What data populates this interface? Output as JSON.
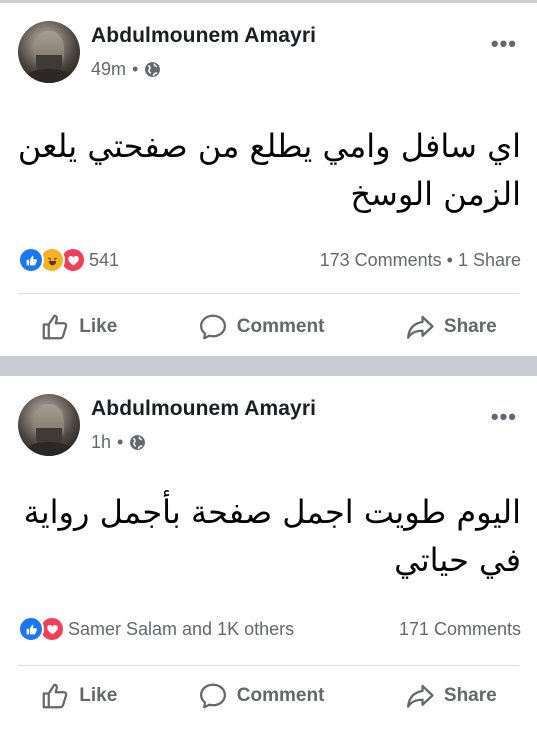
{
  "posts": [
    {
      "author": "Abdulmounem Amayri",
      "time": "49m",
      "time_sep": "•",
      "more": "•••",
      "text": "اي سافل وامي يطلع من صفحتي يلعن الزمن الوسخ",
      "reactions_text": "541",
      "counts_text": "173 Comments • 1 Share",
      "reactions": [
        "like-icon",
        "haha-icon",
        "love-icon"
      ]
    },
    {
      "author": "Abdulmounem Amayri",
      "time": "1h",
      "time_sep": "•",
      "more": "•••",
      "text": "اليوم طويت اجمل صفحة بأجمل رواية في حياتي",
      "reactions_text": "Samer Salam and 1K others",
      "counts_text": "171 Comments",
      "reactions": [
        "like-icon",
        "love-icon"
      ]
    }
  ],
  "actions": {
    "like": "Like",
    "comment": "Comment",
    "share": "Share"
  },
  "colors": {
    "like": "#1877f2",
    "haha": "#f7b125",
    "love": "#f33e58",
    "muted": "#65676b",
    "separator": "#c9ccd1"
  }
}
